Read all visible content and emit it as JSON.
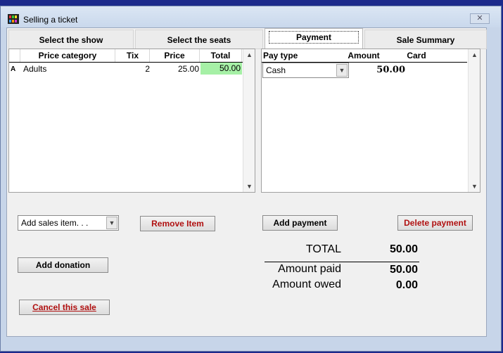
{
  "window": {
    "title": "Selling a ticket",
    "close_glyph": "✕"
  },
  "tabs": [
    {
      "label": "Select the show"
    },
    {
      "label": "Select the seats"
    },
    {
      "label": "Payment"
    },
    {
      "label": "Sale Summary"
    }
  ],
  "items_table": {
    "columns": [
      "Price category",
      "Tix",
      "Price",
      "Total"
    ],
    "rows": [
      {
        "marker": "A",
        "category": "Adults",
        "tix": "2",
        "price": "25.00",
        "total": "50.00"
      }
    ]
  },
  "payments_table": {
    "columns": [
      "Pay type",
      "Amount",
      "Card"
    ],
    "rows": [
      {
        "pay_type": "Cash",
        "amount": "50.00",
        "card": ""
      }
    ]
  },
  "controls": {
    "add_sales_item": "Add sales item. . .",
    "remove_item": "Remove Item",
    "add_payment": "Add payment",
    "delete_payment": "Delete payment",
    "add_donation": "Add donation",
    "cancel_sale": "Cancel this sale"
  },
  "summary": {
    "total_label": "TOTAL",
    "total_value": "50.00",
    "paid_label": "Amount paid",
    "paid_value": "50.00",
    "owed_label": "Amount owed",
    "owed_value": "0.00"
  },
  "colors": {
    "highlight_total": "#a6f0a6",
    "danger_text": "#b01010"
  }
}
